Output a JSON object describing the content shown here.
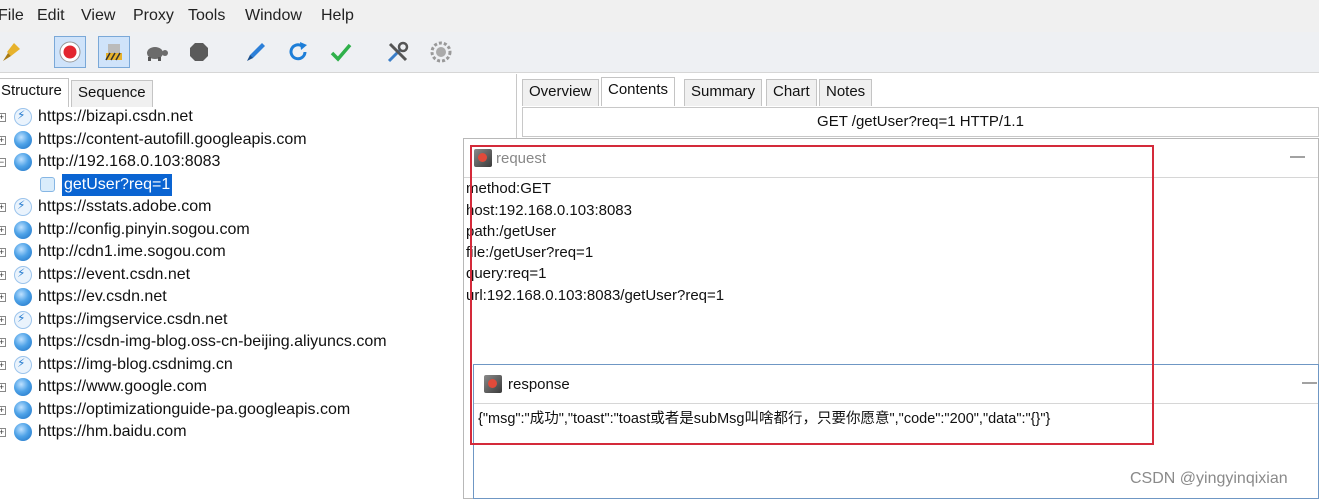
{
  "menu": [
    "File",
    "Edit",
    "View",
    "Proxy",
    "Tools",
    "Window",
    "Help"
  ],
  "toolbar": {
    "icons": [
      "broom-icon",
      "record-icon",
      "throttle-icon",
      "turtle-icon",
      "stop-icon",
      "pen-icon",
      "refresh-icon",
      "validate-icon",
      "tools-icon",
      "settings-icon"
    ]
  },
  "left_tabs": [
    "Structure",
    "Sequence"
  ],
  "tree": [
    {
      "host": "https://bizapi.csdn.net",
      "icon": "bolt"
    },
    {
      "host": "https://content-autofill.googleapis.com",
      "icon": "globe"
    },
    {
      "host": "http://192.168.0.103:8083",
      "icon": "globe",
      "expanded": true
    },
    {
      "host": "getUser?req=1",
      "icon": "request",
      "child": true,
      "selected": true
    },
    {
      "host": "https://sstats.adobe.com",
      "icon": "bolt"
    },
    {
      "host": "http://config.pinyin.sogou.com",
      "icon": "globe"
    },
    {
      "host": "http://cdn1.ime.sogou.com",
      "icon": "globe"
    },
    {
      "host": "https://event.csdn.net",
      "icon": "bolt"
    },
    {
      "host": "https://ev.csdn.net",
      "icon": "globe"
    },
    {
      "host": "https://imgservice.csdn.net",
      "icon": "bolt"
    },
    {
      "host": "https://csdn-img-blog.oss-cn-beijing.aliyuncs.com",
      "icon": "globe"
    },
    {
      "host": "https://img-blog.csdnimg.cn",
      "icon": "bolt"
    },
    {
      "host": "https://www.google.com",
      "icon": "globe"
    },
    {
      "host": "https://optimizationguide-pa.googleapis.com",
      "icon": "globe"
    },
    {
      "host": "https://hm.baidu.com",
      "icon": "globe"
    }
  ],
  "right_tabs": [
    "Overview",
    "Contents",
    "Summary",
    "Chart",
    "Notes"
  ],
  "request_line": "GET /getUser?req=1 HTTP/1.1",
  "request_window": {
    "title": "request",
    "lines": [
      "method:GET",
      "host:192.168.0.103:8083",
      "path:/getUser",
      "file:/getUser?req=1",
      "query:req=1",
      "url:192.168.0.103:8083/getUser?req=1"
    ],
    "minimize": "—"
  },
  "response_window": {
    "title": "response",
    "body": "{\"msg\":\"成功\",\"toast\":\"toast或者是subMsg叫啥都行，只要你愿意\",\"code\":\"200\",\"data\":\"{}\"}",
    "minimize": "—"
  },
  "watermark": "CSDN @yingyinqixian"
}
